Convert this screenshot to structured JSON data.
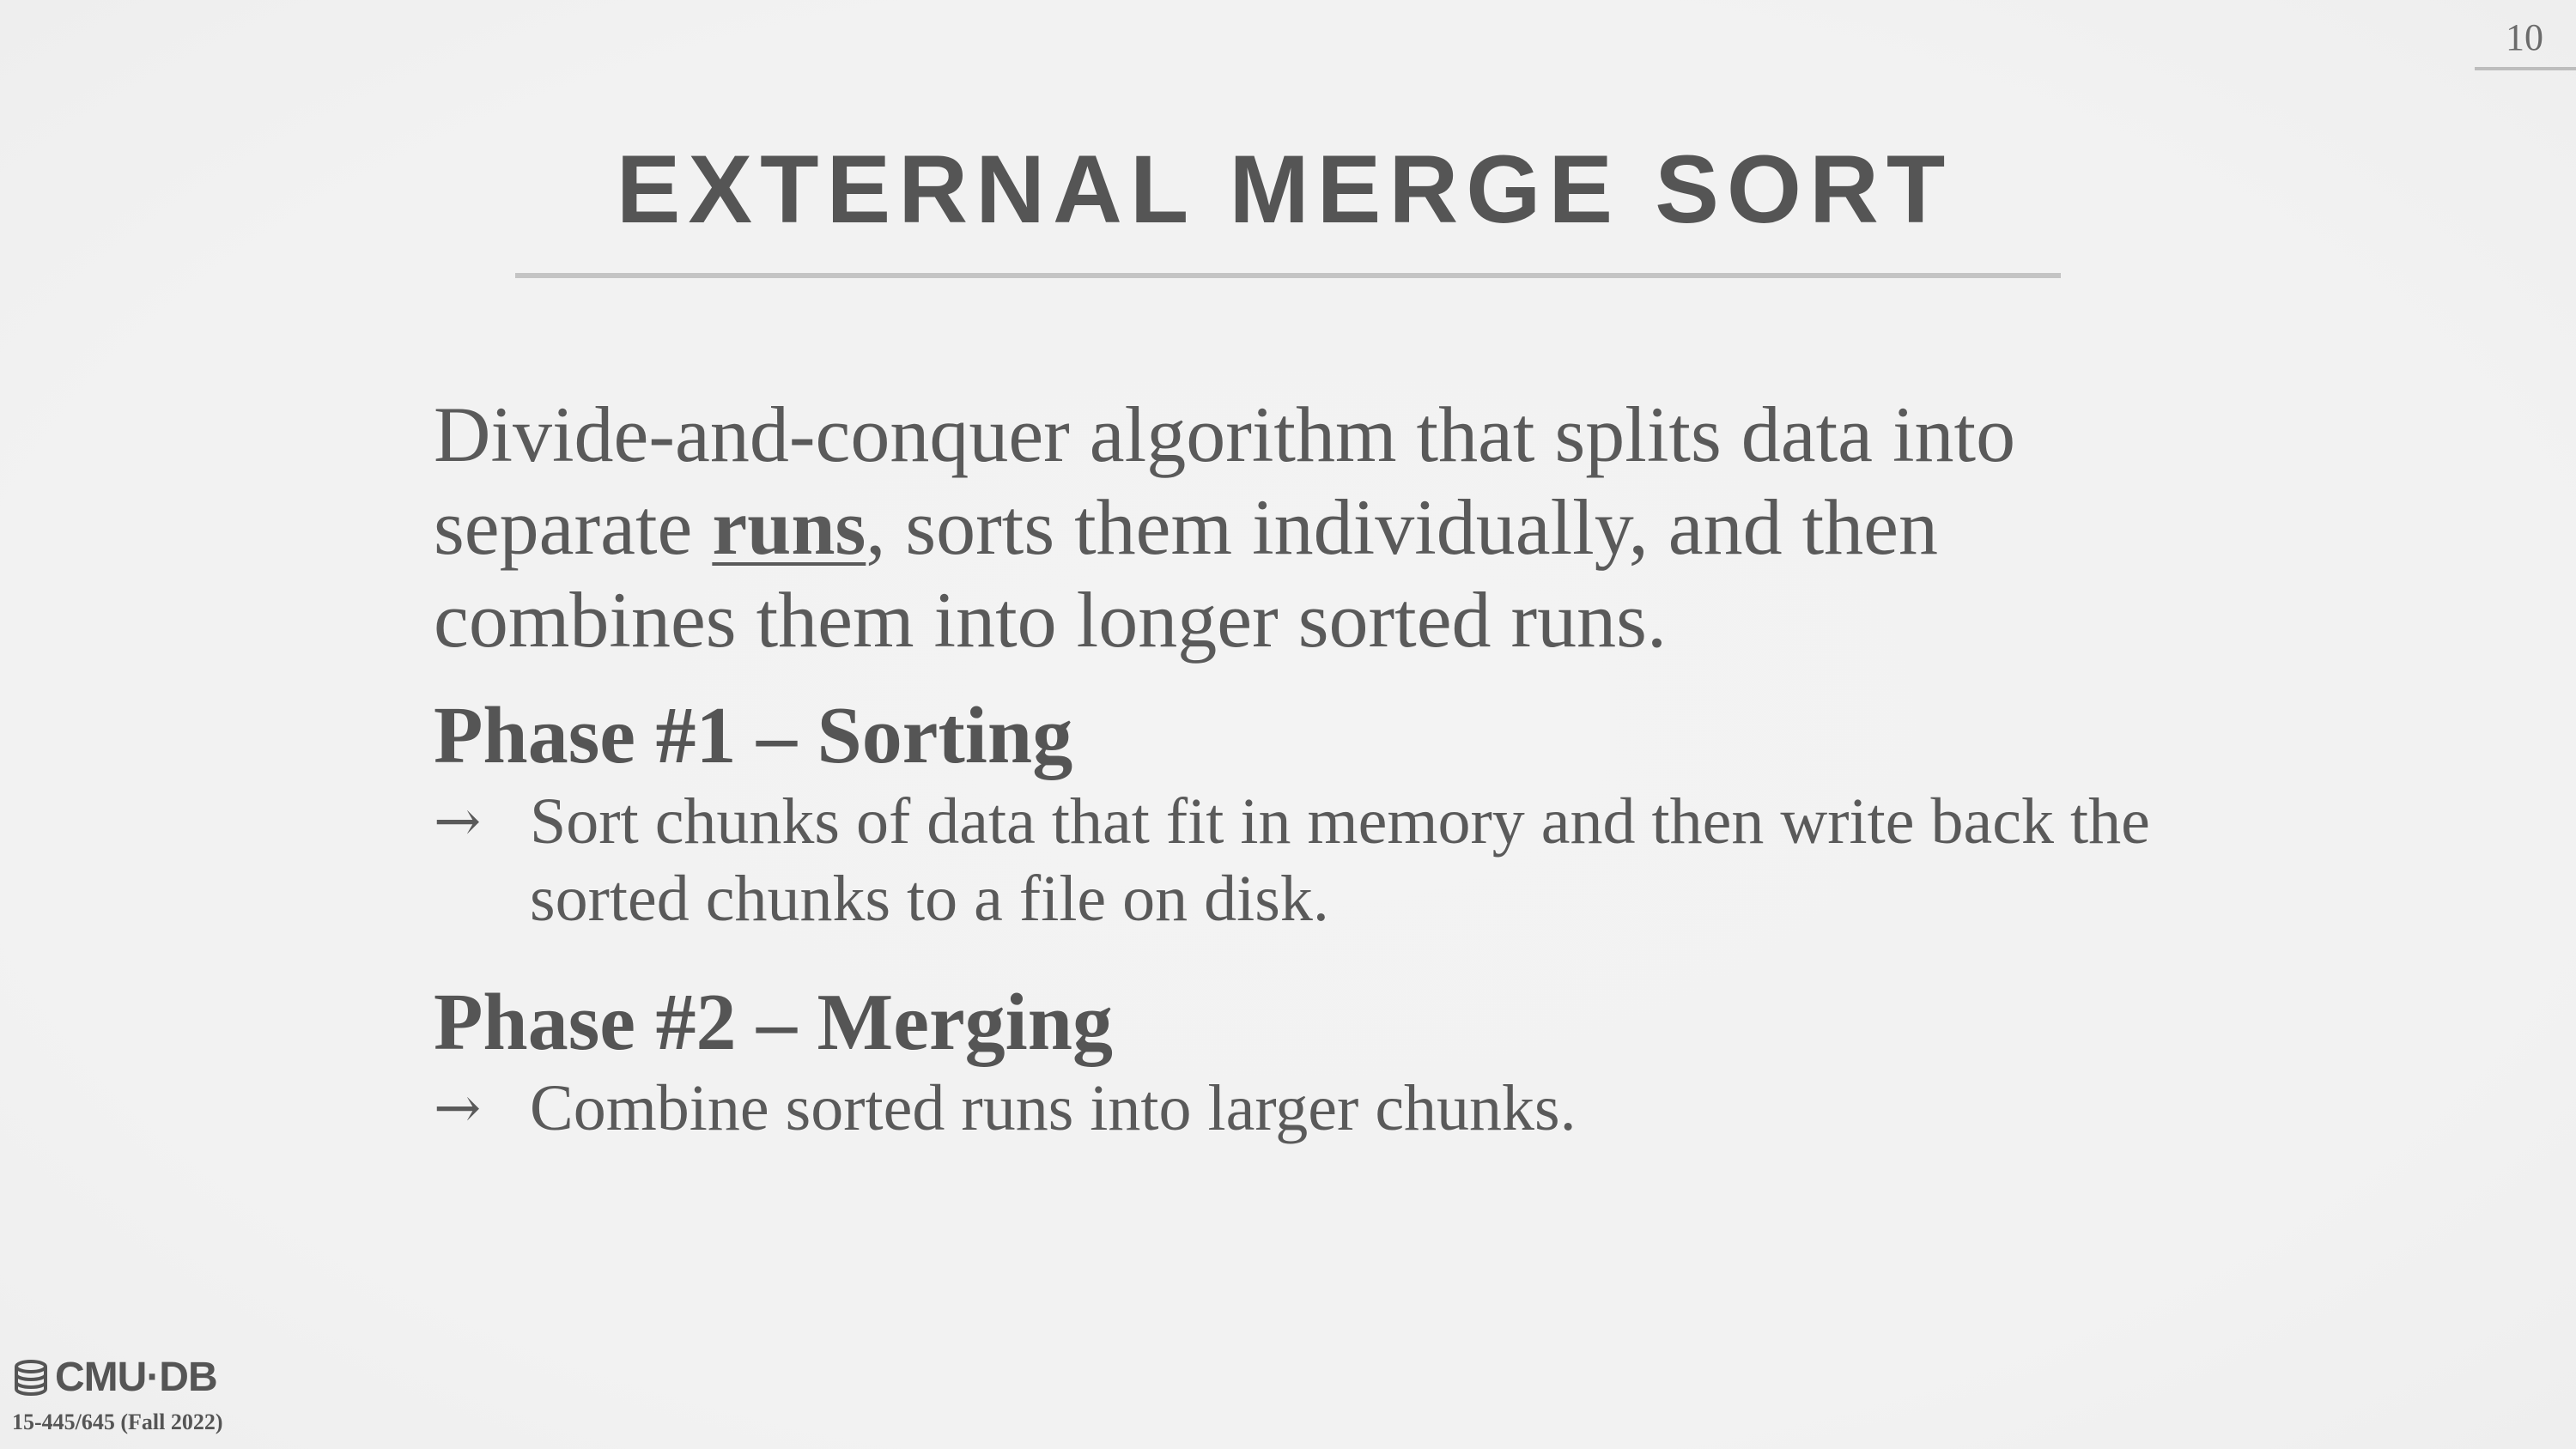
{
  "page_number": "10",
  "title": "EXTERNAL MERGE SORT",
  "intro": {
    "before": "Divide-and-conquer algorithm that splits data into separate ",
    "emphasis": "runs",
    "after": ", sorts them individually, and then combines them into longer sorted runs."
  },
  "phases": [
    {
      "heading": "Phase #1 – Sorting",
      "bullet": "Sort chunks of data that fit in memory and then write back the sorted chunks to a file on disk."
    },
    {
      "heading": "Phase #2 – Merging",
      "bullet": "Combine sorted runs into larger chunks."
    }
  ],
  "bullet_arrow": "→",
  "footer": {
    "logo_text": "CMU·DB",
    "course": "15-445/645 (Fall 2022)"
  },
  "icons": {
    "logo": "database-icon"
  }
}
